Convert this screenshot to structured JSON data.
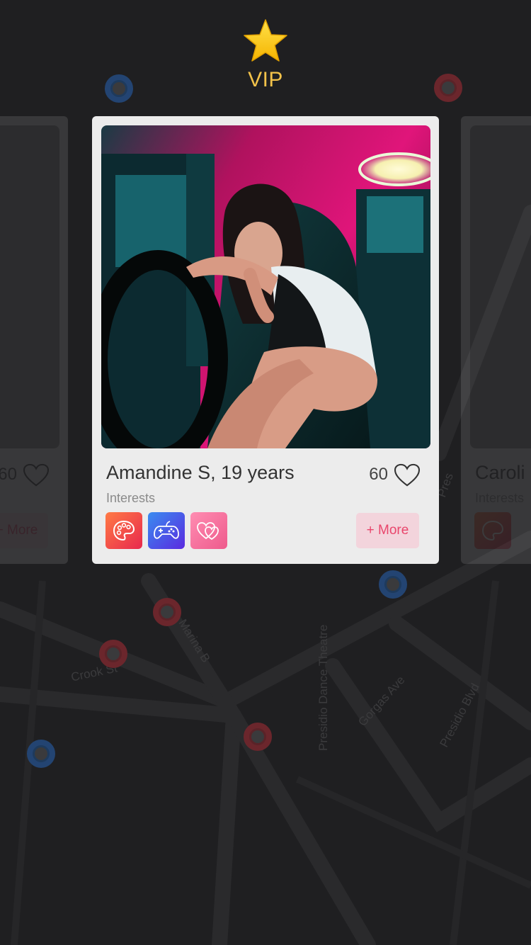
{
  "header": {
    "badge_label": "VIP",
    "badge_icon": "star-icon"
  },
  "map": {
    "labels": [
      "Crook St",
      "Marina B",
      "Presidio Dance Theatre",
      "Gorgas Ave",
      "Presidio Blvd",
      "Pres"
    ]
  },
  "cards": {
    "main": {
      "name_age": "Amandine S, 19 years",
      "likes": "60",
      "interests_label": "Interests",
      "interests": [
        {
          "icon": "palette-icon",
          "colors": [
            "#ff7a45",
            "#e8284d"
          ]
        },
        {
          "icon": "gamepad-icon",
          "colors": [
            "#3a8cf0",
            "#5a2ae0"
          ]
        },
        {
          "icon": "hearts-icon",
          "colors": [
            "#ff8db2",
            "#ee5a8c"
          ]
        }
      ],
      "more_label": "+ More"
    },
    "left": {
      "likes": "60",
      "more_label": "+ More"
    },
    "right": {
      "name_age": "Caroli",
      "interests_label": "Interests"
    }
  },
  "colors": {
    "accent": "#e9466c",
    "vip": "#f2c24a",
    "background": "#1f1f21"
  }
}
